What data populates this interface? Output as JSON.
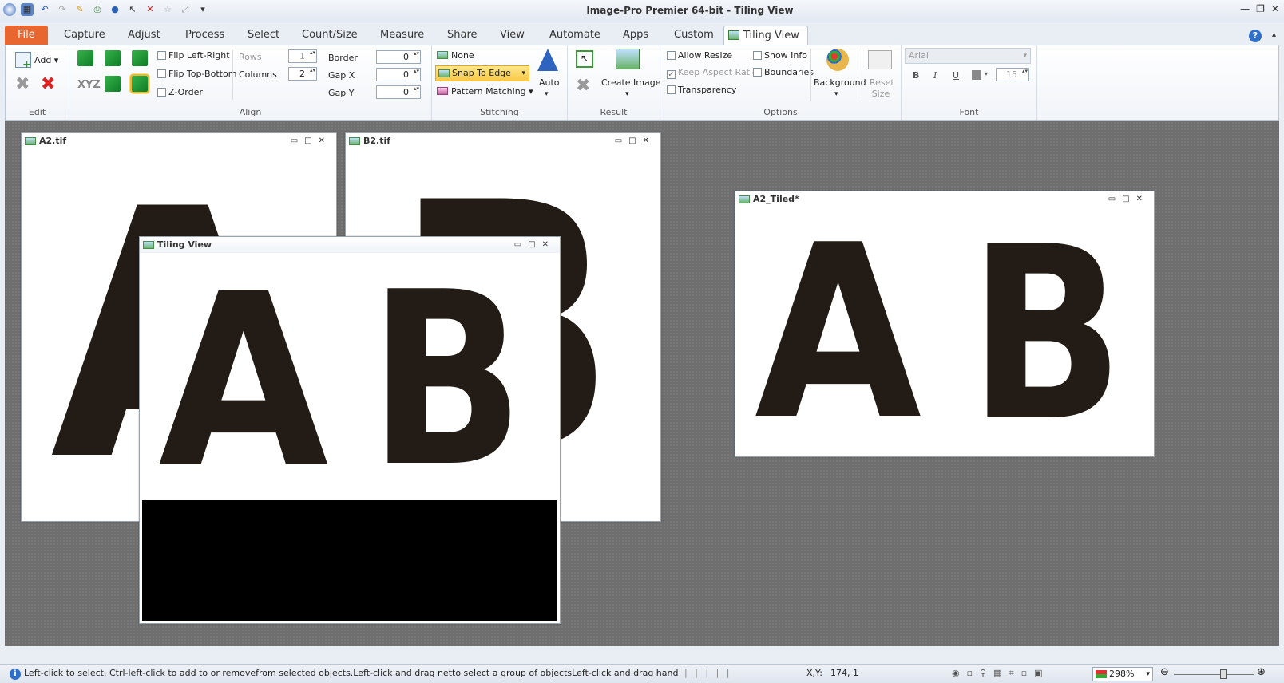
{
  "window": {
    "title": "Image-Pro  Premier 64-bit  -  Tiling  View",
    "controls": [
      "—",
      "❐",
      "✕"
    ]
  },
  "ribbon_tabs": [
    "File",
    "Capture",
    "Adjust",
    "Process",
    "Select",
    "Count/Size",
    "Measure",
    "Share",
    "View",
    "Automate",
    "Apps",
    "Custom",
    "Tiling View"
  ],
  "edit_group": {
    "label": "Edit",
    "add_label": "Add"
  },
  "align_group": {
    "label": "Align",
    "flip_lr": "Flip Left-Right",
    "flip_tb": "Flip Top-Bottom",
    "z_order": "Z-Order",
    "rows_label": "Rows",
    "rows_value": "1",
    "columns_label": "Columns",
    "columns_value": "2",
    "border_label": "Border",
    "border_value": "0",
    "gapx_label": "Gap X",
    "gapx_value": "0",
    "gapy_label": "Gap Y",
    "gapy_value": "0",
    "xyz_label": "XYZ"
  },
  "stitching_group": {
    "label": "Stitching",
    "none": "None",
    "snap": "Snap To Edge",
    "pattern": "Pattern Matching",
    "auto": "Auto"
  },
  "result_group": {
    "label": "Result",
    "create": "Create Image"
  },
  "options_group": {
    "label": "Options",
    "allow_resize": "Allow Resize",
    "keep_aspect": "Keep Aspect Ratio",
    "transparency": "Transparency",
    "show_info": "Show Info",
    "boundaries": "Boundaries",
    "background": "Background",
    "reset_size": "Reset Size"
  },
  "font_group": {
    "label": "Font",
    "font_name": "Arial",
    "bold": "B",
    "italic": "I",
    "underline": "U",
    "size": "15"
  },
  "documents": {
    "a2": {
      "title": "A2.tif",
      "letter": "A"
    },
    "b2": {
      "title": "B2.tif",
      "letter": "B"
    },
    "tiling": {
      "title": "Tiling View",
      "letter_a": "A",
      "letter_b": "B"
    },
    "tiled": {
      "title": "A2_Tiled*",
      "letter_a": "A",
      "letter_b": "B"
    }
  },
  "statusbar": {
    "message": "Left-click to select. Ctrl-left-click to add to or removefrom selected objects.Left-click and drag netto select a group of objectsLeft-click and drag hand to move selecte...",
    "xy_label": "X,Y:",
    "xy_value": "174,     1",
    "zoom": "298%",
    "zoom_level": 0.62
  }
}
